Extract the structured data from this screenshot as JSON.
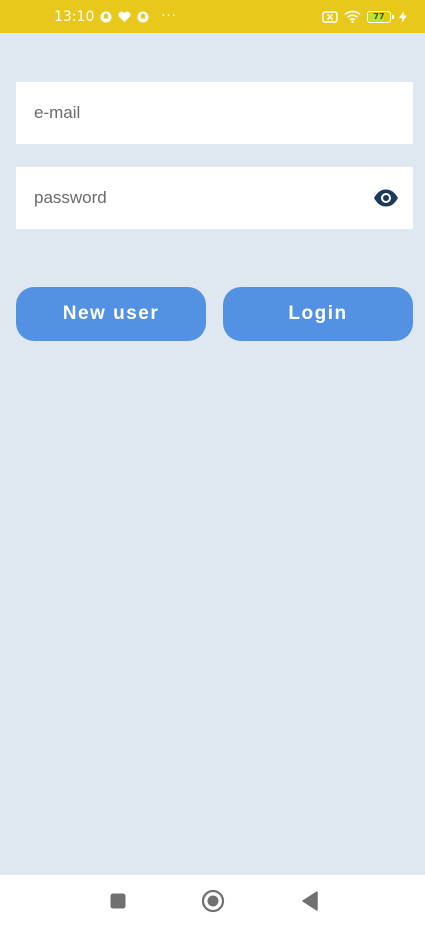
{
  "status_bar": {
    "time": "13:10",
    "more_indicator": "···",
    "battery_level": 77,
    "battery_label": "77",
    "left_icons": [
      "notification-icon",
      "heart-icon",
      "notification-icon"
    ],
    "right_icons": [
      "sim-x-icon",
      "wifi-icon",
      "battery-icon",
      "charging-icon"
    ],
    "background_color": "#e8c81a"
  },
  "login_form": {
    "email_placeholder": "e-mail",
    "email_value": "",
    "password_placeholder": "password",
    "password_value": "",
    "password_toggle_icon": "eye-icon"
  },
  "buttons": {
    "new_user_label": "New user",
    "login_label": "Login",
    "color": "#5392e3"
  },
  "navigation_bar": {
    "icons": [
      "recents-square-icon",
      "home-circle-icon",
      "back-triangle-icon"
    ]
  },
  "colors": {
    "background": "#dfe7f0",
    "accent": "#5392e3",
    "eye_icon": "#1c3a5c"
  }
}
